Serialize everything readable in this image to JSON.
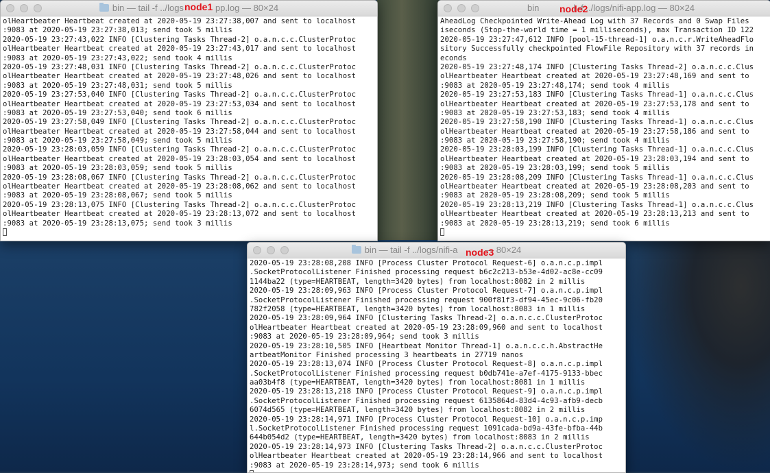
{
  "windows": {
    "node1": {
      "label": "node1",
      "title_left": "bin — tail -f ../logs",
      "title_right": "pp.log — 80×24",
      "lines": [
        "olHeartbeater Heartbeat created at 2020-05-19 23:27:38,007 and sent to localhost",
        ":9083 at 2020-05-19 23:27:38,013; send took 5 millis",
        "2020-05-19 23:27:43,022 INFO [Clustering Tasks Thread-2] o.a.n.c.c.ClusterProtoc",
        "olHeartbeater Heartbeat created at 2020-05-19 23:27:43,017 and sent to localhost",
        ":9083 at 2020-05-19 23:27:43,022; send took 4 millis",
        "2020-05-19 23:27:48,031 INFO [Clustering Tasks Thread-2] o.a.n.c.c.ClusterProtoc",
        "olHeartbeater Heartbeat created at 2020-05-19 23:27:48,026 and sent to localhost",
        ":9083 at 2020-05-19 23:27:48,031; send took 5 millis",
        "2020-05-19 23:27:53,040 INFO [Clustering Tasks Thread-2] o.a.n.c.c.ClusterProtoc",
        "olHeartbeater Heartbeat created at 2020-05-19 23:27:53,034 and sent to localhost",
        ":9083 at 2020-05-19 23:27:53,040; send took 6 millis",
        "2020-05-19 23:27:58,049 INFO [Clustering Tasks Thread-2] o.a.n.c.c.ClusterProtoc",
        "olHeartbeater Heartbeat created at 2020-05-19 23:27:58,044 and sent to localhost",
        ":9083 at 2020-05-19 23:27:58,049; send took 5 millis",
        "2020-05-19 23:28:03,059 INFO [Clustering Tasks Thread-2] o.a.n.c.c.ClusterProtoc",
        "olHeartbeater Heartbeat created at 2020-05-19 23:28:03,054 and sent to localhost",
        ":9083 at 2020-05-19 23:28:03,059; send took 5 millis",
        "2020-05-19 23:28:08,067 INFO [Clustering Tasks Thread-2] o.a.n.c.c.ClusterProtoc",
        "olHeartbeater Heartbeat created at 2020-05-19 23:28:08,062 and sent to localhost",
        ":9083 at 2020-05-19 23:28:08,067; send took 5 millis",
        "2020-05-19 23:28:13,075 INFO [Clustering Tasks Thread-2] o.a.n.c.c.ClusterProtoc",
        "olHeartbeater Heartbeat created at 2020-05-19 23:28:13,072 and sent to localhost",
        ":9083 at 2020-05-19 23:28:13,075; send took 3 millis"
      ]
    },
    "node2": {
      "label": "node2",
      "title_left": "bin",
      "title_right": "l -f ../logs/nifi-app.log — 80×24",
      "lines": [
        "AheadLog Checkpointed Write-Ahead Log with 37 Records and 0 Swap Files",
        "iseconds (Stop-the-world time = 1 milliseconds), max Transaction ID 122",
        "2020-05-19 23:27:47,612 INFO [pool-15-thread-1] o.a.n.c.r.WriteAheadFlo",
        "sitory Successfully checkpointed FlowFile Repository with 37 records in",
        "econds",
        "2020-05-19 23:27:48,174 INFO [Clustering Tasks Thread-2] o.a.n.c.c.Clus",
        "olHeartbeater Heartbeat created at 2020-05-19 23:27:48,169 and sent to",
        ":9083 at 2020-05-19 23:27:48,174; send took 4 millis",
        "2020-05-19 23:27:53,183 INFO [Clustering Tasks Thread-1] o.a.n.c.c.Clus",
        "olHeartbeater Heartbeat created at 2020-05-19 23:27:53,178 and sent to",
        ":9083 at 2020-05-19 23:27:53,183; send took 4 millis",
        "2020-05-19 23:27:58,190 INFO [Clustering Tasks Thread-1] o.a.n.c.c.Clus",
        "olHeartbeater Heartbeat created at 2020-05-19 23:27:58,186 and sent to",
        ":9083 at 2020-05-19 23:27:58,190; send took 4 millis",
        "2020-05-19 23:28:03,199 INFO [Clustering Tasks Thread-1] o.a.n.c.c.Clus",
        "olHeartbeater Heartbeat created at 2020-05-19 23:28:03,194 and sent to",
        ":9083 at 2020-05-19 23:28:03,199; send took 5 millis",
        "2020-05-19 23:28:08,209 INFO [Clustering Tasks Thread-1] o.a.n.c.c.Clus",
        "olHeartbeater Heartbeat created at 2020-05-19 23:28:08,203 and sent to",
        ":9083 at 2020-05-19 23:28:08,209; send took 5 millis",
        "2020-05-19 23:28:13,219 INFO [Clustering Tasks Thread-1] o.a.n.c.c.Clus",
        "olHeartbeater Heartbeat created at 2020-05-19 23:28:13,213 and sent to",
        ":9083 at 2020-05-19 23:28:13,219; send took 6 millis"
      ]
    },
    "node3": {
      "label": "node3",
      "title_left": "bin — tail -f ../logs/nifi-a",
      "title_right": " — 80×24",
      "lines": [
        "2020-05-19 23:28:08,208 INFO [Process Cluster Protocol Request-6] o.a.n.c.p.impl",
        ".SocketProtocolListener Finished processing request b6c2c213-b53e-4d02-ac8e-cc09",
        "1144ba22 (type=HEARTBEAT, length=3420 bytes) from localhost:8082 in 2 millis",
        "2020-05-19 23:28:09,963 INFO [Process Cluster Protocol Request-7] o.a.n.c.p.impl",
        ".SocketProtocolListener Finished processing request 900f81f3-df94-45ec-9c06-fb20",
        "782f2058 (type=HEARTBEAT, length=3420 bytes) from localhost:8083 in 1 millis",
        "2020-05-19 23:28:09,964 INFO [Clustering Tasks Thread-2] o.a.n.c.c.ClusterProtoc",
        "olHeartbeater Heartbeat created at 2020-05-19 23:28:09,960 and sent to localhost",
        ":9083 at 2020-05-19 23:28:09,964; send took 3 millis",
        "2020-05-19 23:28:10,505 INFO [Heartbeat Monitor Thread-1] o.a.n.c.c.h.AbstractHe",
        "artbeatMonitor Finished processing 3 heartbeats in 27719 nanos",
        "2020-05-19 23:28:13,074 INFO [Process Cluster Protocol Request-8] o.a.n.c.p.impl",
        ".SocketProtocolListener Finished processing request b0db741e-a7ef-4175-9133-bbec",
        "aa03b4f8 (type=HEARTBEAT, length=3420 bytes) from localhost:8081 in 1 millis",
        "2020-05-19 23:28:13,218 INFO [Process Cluster Protocol Request-9] o.a.n.c.p.impl",
        ".SocketProtocolListener Finished processing request 6135864d-83d4-4c93-afb9-decb",
        "6074d565 (type=HEARTBEAT, length=3420 bytes) from localhost:8082 in 2 millis",
        "2020-05-19 23:28:14,971 INFO [Process Cluster Protocol Request-10] o.a.n.c.p.imp",
        "l.SocketProtocolListener Finished processing request 1091cada-bd9a-43fe-bfba-44b",
        "644b054d2 (type=HEARTBEAT, length=3420 bytes) from localhost:8083 in 2 millis",
        "2020-05-19 23:28:14,973 INFO [Clustering Tasks Thread-2] o.a.n.c.c.ClusterProtoc",
        "olHeartbeater Heartbeat created at 2020-05-19 23:28:14,966 and sent to localhost",
        ":9083 at 2020-05-19 23:28:14,973; send took 6 millis"
      ]
    }
  }
}
